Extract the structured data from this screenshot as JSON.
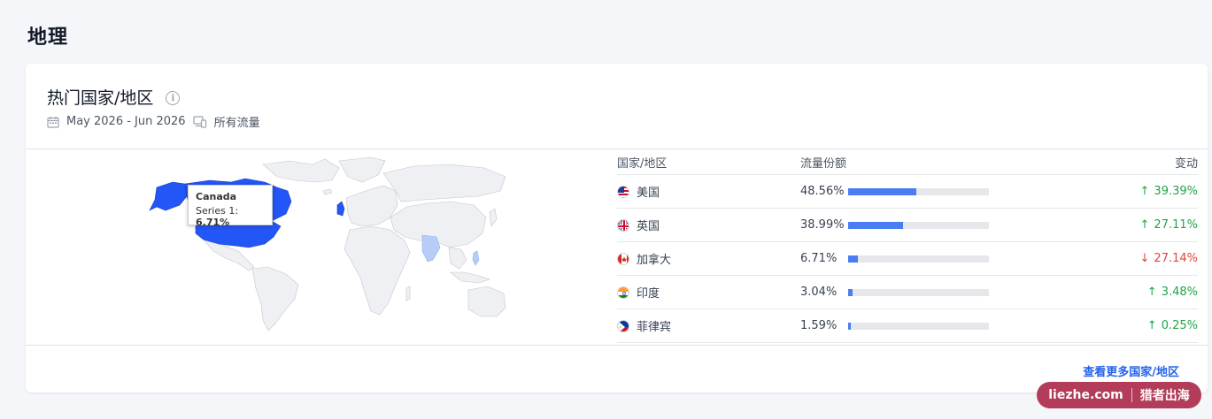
{
  "section_title": "地理",
  "card": {
    "title": "热门国家/地区",
    "date_range": "May 2026 - Jun 2026",
    "traffic_filter": "所有流量",
    "more_link": "查看更多国家/地区"
  },
  "map": {
    "tooltip": {
      "country": "Canada",
      "series_label": "Series 1:",
      "value": "6.71%"
    },
    "colors": {
      "highlight": "#2356f6",
      "light": "#b8cdf5",
      "base": "#eef0f3",
      "border": "#c3c7cc"
    }
  },
  "table": {
    "headers": {
      "country": "国家/地区",
      "share": "流量份额",
      "change": "变动"
    },
    "rows": [
      {
        "flag": "us-flag-icon",
        "country": "美国",
        "share": "48.56%",
        "share_value": 48.56,
        "direction": "up",
        "change": "39.39%"
      },
      {
        "flag": "uk-flag-icon",
        "country": "英国",
        "share": "38.99%",
        "share_value": 38.99,
        "direction": "up",
        "change": "27.11%"
      },
      {
        "flag": "ca-flag-icon",
        "country": "加拿大",
        "share": "6.71%",
        "share_value": 6.71,
        "direction": "down",
        "change": "27.14%"
      },
      {
        "flag": "in-flag-icon",
        "country": "印度",
        "share": "3.04%",
        "share_value": 3.04,
        "direction": "up",
        "change": "3.48%"
      },
      {
        "flag": "ph-flag-icon",
        "country": "菲律宾",
        "share": "1.59%",
        "share_value": 1.59,
        "direction": "up",
        "change": "0.25%"
      }
    ]
  },
  "colors": {
    "accent": "#4a7cf2",
    "up": "#22a447",
    "down": "#e0443b",
    "link": "#2563eb"
  },
  "watermark": {
    "left": "liezhe.com",
    "right": "猎者出海"
  }
}
